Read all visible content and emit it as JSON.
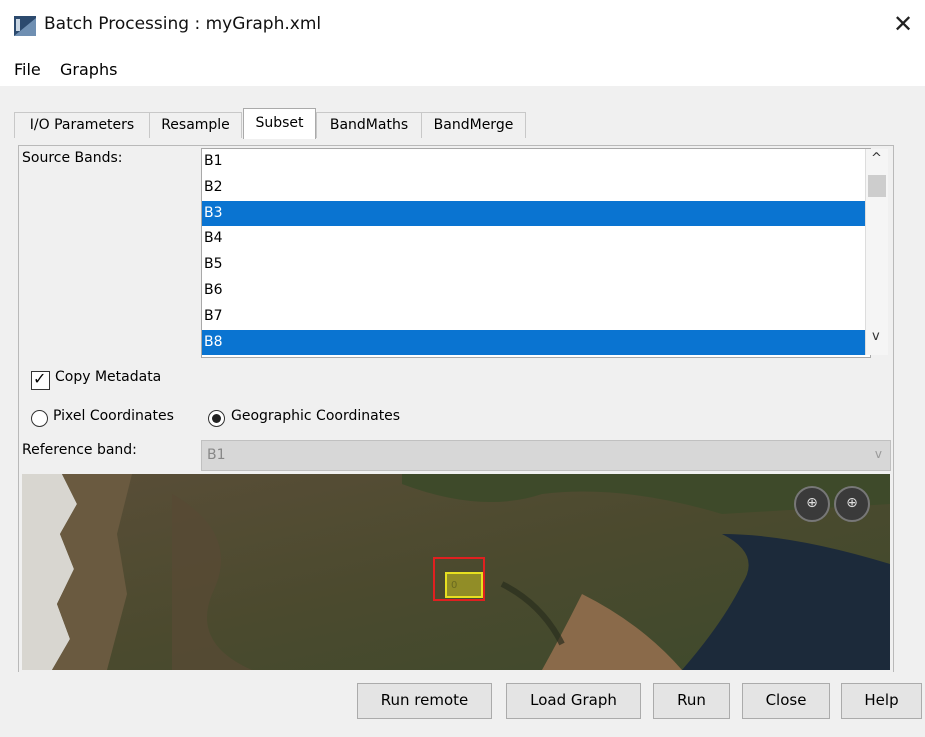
{
  "window": {
    "title": "Batch Processing : myGraph.xml",
    "close_glyph": "✕"
  },
  "menu": {
    "items": [
      "File",
      "Graphs"
    ]
  },
  "tabs": [
    "I/O Parameters",
    "Resample",
    "Subset",
    "BandMaths",
    "BandMerge"
  ],
  "active_tab": "Subset",
  "subset": {
    "source_bands_label": "Source Bands:",
    "bands": [
      "B1",
      "B2",
      "B3",
      "B4",
      "B5",
      "B6",
      "B7",
      "B8"
    ],
    "selected_bands": [
      "B3",
      "B8"
    ],
    "copy_metadata_label": "Copy Metadata",
    "copy_metadata_checked": true,
    "pixel_coords_label": "Pixel Coordinates",
    "geo_coords_label": "Geographic Coordinates",
    "coordinate_mode": "geographic",
    "reference_band_label": "Reference band:",
    "reference_band_value": "B1",
    "map_box_label": "0"
  },
  "footer": {
    "buttons": [
      "Run remote",
      "Load Graph",
      "Run",
      "Close",
      "Help"
    ]
  },
  "icons": {
    "scroll_up": "^",
    "scroll_down": "v",
    "dropdown": "v",
    "checkmark": "✓",
    "zoom_all": "⊕",
    "zoom_data": "⊕"
  },
  "colors": {
    "selection": "#0a74d1",
    "subset_outer": "#e02020",
    "subset_inner": "#e8e020"
  }
}
